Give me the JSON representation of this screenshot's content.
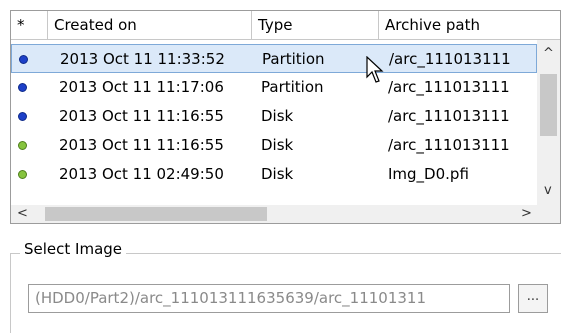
{
  "table": {
    "columns": [
      "*",
      "Created on",
      "Type",
      "Archive path"
    ],
    "rows": [
      {
        "status": "blue",
        "created": "2013 Oct 11 11:33:52",
        "type": "Partition",
        "path": "/arc_111013111",
        "selected": true
      },
      {
        "status": "blue",
        "created": "2013 Oct 11 11:17:06",
        "type": "Partition",
        "path": "/arc_111013111",
        "selected": false
      },
      {
        "status": "blue",
        "created": "2013 Oct 11 11:16:55",
        "type": "Disk",
        "path": "/arc_111013111",
        "selected": false
      },
      {
        "status": "green",
        "created": "2013 Oct 11 11:16:55",
        "type": "Disk",
        "path": "/arc_111013111",
        "selected": false
      },
      {
        "status": "green",
        "created": "2013 Oct 11 02:49:50",
        "type": "Disk",
        "path": "Img_D0.pfi",
        "selected": false
      }
    ]
  },
  "scroll": {
    "up_arrow": "^",
    "down_arrow": "v",
    "left_arrow": "<",
    "right_arrow": ">"
  },
  "select_image": {
    "title": "Select Image",
    "path_value": "(HDD0/Part2)/arc_111013111635639/arc_11101311",
    "browse_label": "..."
  },
  "colors": {
    "status_blue": "#1d40c8",
    "status_green": "#86c43e",
    "selection": "#dbe9f9"
  }
}
